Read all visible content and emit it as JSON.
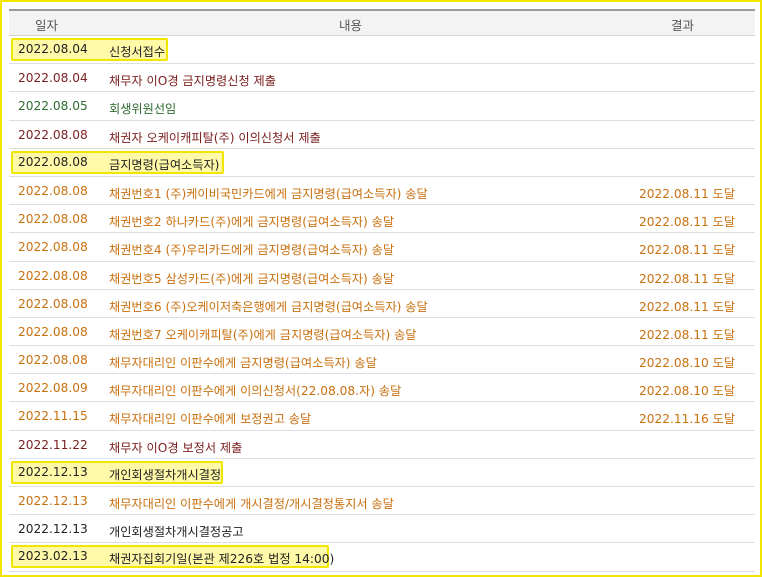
{
  "header": {
    "date": "일자",
    "content": "내용",
    "result": "결과"
  },
  "rows": [
    {
      "date": "2022.08.04",
      "content": "신청서접수",
      "result": "",
      "color": "black",
      "highlight": true
    },
    {
      "date": "2022.08.04",
      "content": "채무자 이O경 금지명령신청 제출",
      "result": "",
      "color": "maroon",
      "highlight": false
    },
    {
      "date": "2022.08.05",
      "content": "회생위원선임",
      "result": "",
      "color": "green",
      "highlight": false
    },
    {
      "date": "2022.08.08",
      "content": "채권자 오케이캐피탈(주) 이의신청서 제출",
      "result": "",
      "color": "maroon",
      "highlight": false
    },
    {
      "date": "2022.08.08",
      "content": "금지명령(급여소득자)",
      "result": "",
      "color": "black",
      "highlight": true
    },
    {
      "date": "2022.08.08",
      "content": "채권번호1 (주)케이비국민카드에게 금지명령(급여소득자) 송달",
      "result": "2022.08.11 도달",
      "color": "orange",
      "highlight": false
    },
    {
      "date": "2022.08.08",
      "content": "채권번호2 하나카드(주)에게 금지명령(급여소득자) 송달",
      "result": "2022.08.11 도달",
      "color": "orange",
      "highlight": false
    },
    {
      "date": "2022.08.08",
      "content": "채권번호4 (주)우리카드에게 금지명령(급여소득자) 송달",
      "result": "2022.08.11 도달",
      "color": "orange",
      "highlight": false
    },
    {
      "date": "2022.08.08",
      "content": "채권번호5 삼성카드(주)에게 금지명령(급여소득자) 송달",
      "result": "2022.08.11 도달",
      "color": "orange",
      "highlight": false
    },
    {
      "date": "2022.08.08",
      "content": "채권번호6 (주)오케이저축은행에게 금지명령(급여소득자) 송달",
      "result": "2022.08.11 도달",
      "color": "orange",
      "highlight": false
    },
    {
      "date": "2022.08.08",
      "content": "채권번호7 오케이캐피탈(주)에게 금지명령(급여소득자) 송달",
      "result": "2022.08.11 도달",
      "color": "orange",
      "highlight": false
    },
    {
      "date": "2022.08.08",
      "content": "채무자대리인 이판수에게 금지명령(급여소득자) 송달",
      "result": "2022.08.10 도달",
      "color": "orange",
      "highlight": false
    },
    {
      "date": "2022.08.09",
      "content": "채무자대리인 이판수에게 이의신청서(22.08.08.자) 송달",
      "result": "2022.08.10 도달",
      "color": "orange",
      "highlight": false
    },
    {
      "date": "2022.11.15",
      "content": "채무자대리인 이판수에게 보정권고 송달",
      "result": "2022.11.16 도달",
      "color": "orange",
      "highlight": false
    },
    {
      "date": "2022.11.22",
      "content": "채무자 이O경 보정서 제출",
      "result": "",
      "color": "maroon",
      "highlight": false
    },
    {
      "date": "2022.12.13",
      "content": "개인회생절차개시결정",
      "result": "",
      "color": "black",
      "highlight": true
    },
    {
      "date": "2022.12.13",
      "content": "채무자대리인 이판수에게 개시결정/개시결정통지서 송달",
      "result": "",
      "color": "orange",
      "highlight": false
    },
    {
      "date": "2022.12.13",
      "content": "개인회생절차개시결정공고",
      "result": "",
      "color": "black",
      "highlight": false
    },
    {
      "date": "2023.02.13",
      "content": "채권자집회기일(본관 제226호 법정 14:00)",
      "result": "",
      "color": "black",
      "highlight": true
    }
  ],
  "colors": {
    "frame": "#f2e600",
    "highlight_fill": "#fff9a8",
    "orange": "#c9700f",
    "maroon": "#7a1e1e",
    "green": "#2f6b2f"
  }
}
